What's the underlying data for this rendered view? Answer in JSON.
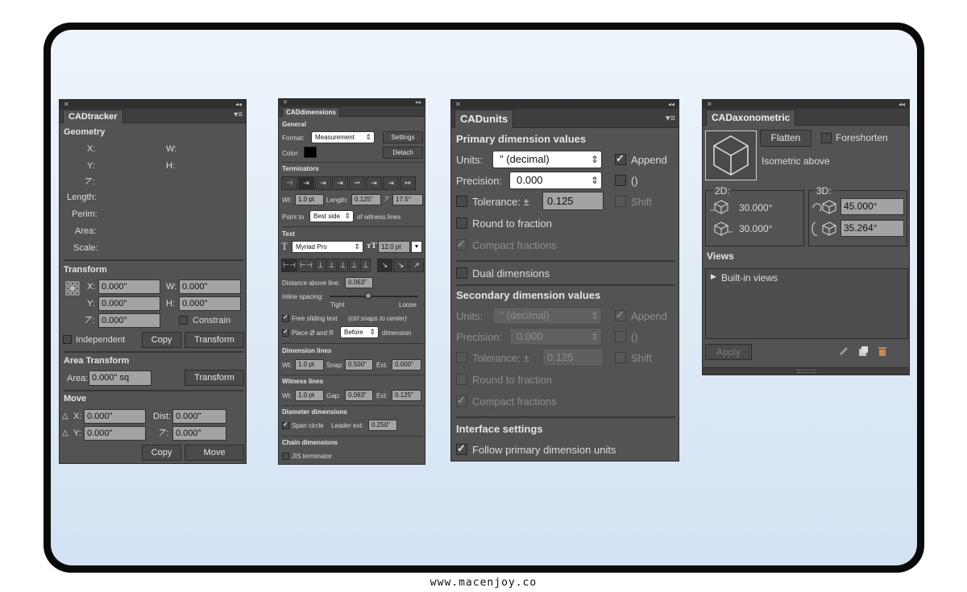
{
  "footer": "www.macenjoy.co",
  "tracker": {
    "tab": "CADtracker",
    "geometry": "Geometry",
    "x": "X:",
    "w": "W:",
    "y": "Y:",
    "h": "H:",
    "angle": "⦢:",
    "length": "Length:",
    "perim": "Perim:",
    "area": "Area:",
    "scale": "Scale:",
    "transform": "Transform",
    "tx_label": "X:",
    "tx": "0.000\"",
    "tw_label": "W:",
    "tw": "0.000\"",
    "ty_label": "Y:",
    "ty": "0.000\"",
    "th_label": "H:",
    "th": "0.000\"",
    "ta_label": "⦢:",
    "ta": "0.000°",
    "constrain": "Constrain",
    "independent": "Independent",
    "copy": "Copy",
    "transform_btn": "Transform",
    "area_transform": "Area Transform",
    "area_label": "Area:",
    "area_value": "0.000\" sq",
    "area_transform_btn": "Transform",
    "move": "Move",
    "mx_label": "X:",
    "mx": "0.000\"",
    "dist_label": "Dist:",
    "dist": "0.000\"",
    "my_label": "Y:",
    "my": "0.000\"",
    "ma_label": "⦢:",
    "ma": "0.000°",
    "move_copy": "Copy",
    "move_btn": "Move"
  },
  "dims": {
    "tab": "CADdimensions",
    "general": "General",
    "format_label": "Format:",
    "format": "Measurement",
    "settings": "Settings",
    "color_label": "Color:",
    "detach": "Detach",
    "terminators": "Terminators",
    "wt_label": "Wt:",
    "wt": "1.0 pt",
    "length_label": "Length:",
    "length": "0.125\"",
    "angle": "17.5°",
    "point_to": "Point to",
    "best_side": "Best side",
    "of_witness": "of witness lines",
    "text": "Text",
    "font": "Myriad Pro",
    "font_size": "12.0 pt",
    "distance_label": "Distance above line:",
    "distance": "0.063\"",
    "inline_label": "Inline spacing:",
    "tight": "Tight",
    "loose": "Loose",
    "free_sliding": "Free sliding text",
    "ctrl_snaps": "(ctrl snaps to center)",
    "place": "Place Ø and R",
    "before": "Before",
    "dimension": "dimension",
    "dim_lines": "Dimension lines",
    "dl_wt_label": "Wt:",
    "dl_wt": "1.0 pt",
    "snap_label": "Snap:",
    "snap": "0.500\"",
    "ext_label": "Ext:",
    "ext": "0.000\"",
    "witness": "Witness lines",
    "wl_wt_label": "Wt:",
    "wl_wt": "1.0 pt",
    "gap_label": "Gap:",
    "gap": "0.063\"",
    "wl_ext_label": "Ext:",
    "wl_ext": "0.125\"",
    "diameter": "Diameter dimensions",
    "span": "Span circle",
    "leader_label": "Leader ext:",
    "leader": "0.250\"",
    "chain": "Chain dimensions",
    "jis": "JIS terminator"
  },
  "units": {
    "tab": "CADunits",
    "primary": "Primary dimension values",
    "units_label": "Units:",
    "units_value": "\" (decimal)",
    "append": "Append",
    "precision_label": "Precision:",
    "precision": "0.000",
    "paren": "()",
    "tolerance": "Tolerance: ±",
    "tolerance_value": "0.125",
    "shift": "Shift",
    "round": "Round to fraction",
    "compact": "Compact fractions",
    "dual": "Dual dimensions",
    "secondary": "Secondary dimension values",
    "s_units_label": "Units:",
    "s_units": "\" (decimal)",
    "s_append": "Append",
    "s_precision_label": "Precision:",
    "s_precision": "0.000",
    "s_paren": "()",
    "s_tolerance": "Tolerance: ±",
    "s_tolerance_value": "0.125",
    "s_shift": "Shift",
    "s_round": "Round to fraction",
    "s_compact": "Compact fractions",
    "interface": "Interface settings",
    "follow": "Follow primary dimension units"
  },
  "axo": {
    "tab": "CADaxonometric",
    "flatten": "Flatten",
    "foreshorten": "Foreshorten",
    "iso": "Isometric above",
    "label_2d": "2D:",
    "label_3d": "3D:",
    "v2d_1": "30.000°",
    "v2d_2": "30.000°",
    "v3d_1": "45.000°",
    "v3d_2": "35.264°",
    "views": "Views",
    "builtin": "Built-in views",
    "apply": "Apply"
  }
}
